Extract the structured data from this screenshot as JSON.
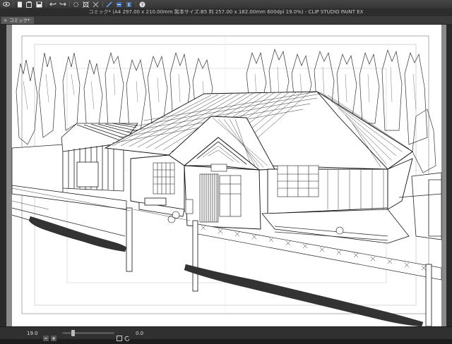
{
  "app": {
    "window_title": "コミック* (A4 297.00 x 210.00mm 製本サイズ:B5 判 257.00 x 182.00mm 600dpi 19.0%) - CLIP STUDIO PAINT EX"
  },
  "tabs": [
    {
      "label": "コミック*"
    }
  ],
  "toolbar": {
    "icons": [
      "eye-icon",
      "new-icon",
      "open-icon",
      "save-icon",
      "undo-icon",
      "redo-icon",
      "transform-icon",
      "crop-icon",
      "ruler-icon",
      "snap-icon",
      "help-icon"
    ]
  },
  "status": {
    "zoom": "19.0",
    "zoom_level": 0.19,
    "angle": "0.0"
  },
  "colors": {
    "ui_bg": "#1e1e1e",
    "toolbar": "#3d3d3d",
    "canvas_bg": "#5e5e5e",
    "paper": "#ffffff",
    "frame_guide": "#a0a0a0"
  }
}
